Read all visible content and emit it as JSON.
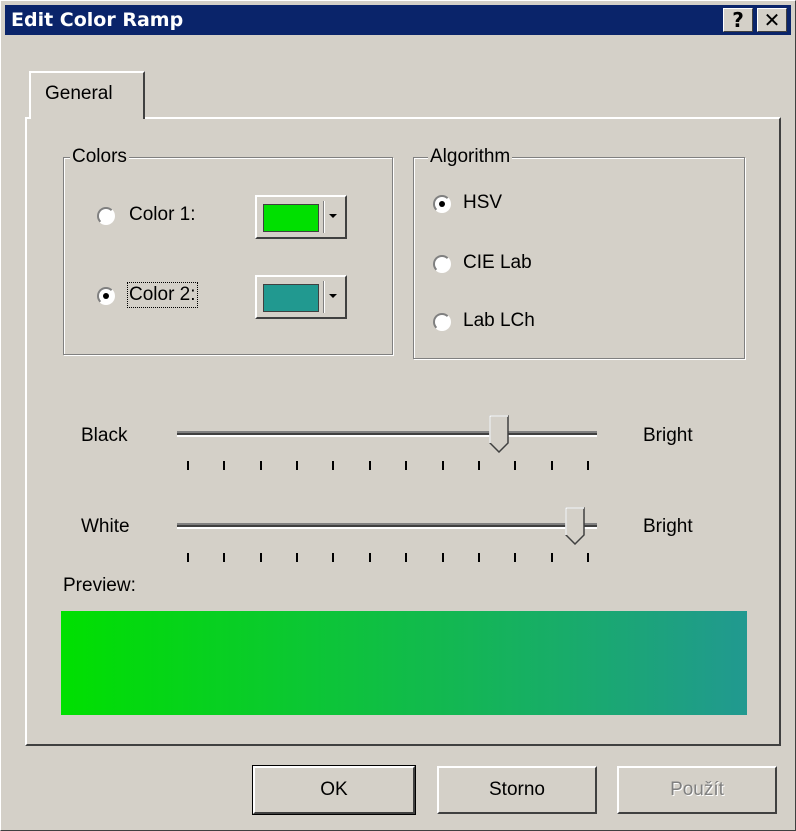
{
  "window": {
    "title": "Edit Color Ramp",
    "help_label": "?",
    "close_label": "✕",
    "title_bar_color": "#0a246a"
  },
  "tabs": [
    {
      "label": "General",
      "selected": true
    }
  ],
  "colors_group": {
    "legend": "Colors",
    "items": [
      {
        "label": "Color 1:",
        "selected": false,
        "swatch": "#00e000"
      },
      {
        "label": "Color 2:",
        "selected": true,
        "swatch": "#219990"
      }
    ]
  },
  "algorithm_group": {
    "legend": "Algorithm",
    "options": [
      {
        "label": "HSV",
        "selected": true
      },
      {
        "label": "CIE Lab",
        "selected": false
      },
      {
        "label": "Lab LCh",
        "selected": false
      }
    ]
  },
  "sliders": [
    {
      "left_label": "Black",
      "right_label": "Bright",
      "value_fraction": 0.78,
      "tick_count": 12
    },
    {
      "left_label": "White",
      "right_label": "Bright",
      "value_fraction": 0.97,
      "tick_count": 12
    }
  ],
  "preview": {
    "label": "Preview:",
    "gradient_start": "#00e000",
    "gradient_end": "#219990"
  },
  "buttons": {
    "ok": "OK",
    "cancel": "Storno",
    "apply": "Použít"
  }
}
